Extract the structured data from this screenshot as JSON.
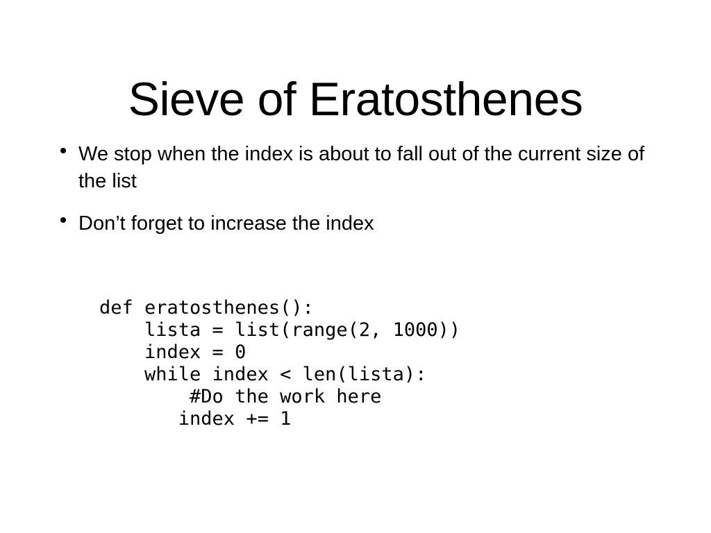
{
  "slide": {
    "background_color": "#ffffff",
    "text_color": "#000000",
    "title": "Sieve of Eratosthenes",
    "bullets": [
      {
        "text": "We stop when the index is about to fall out of the current size of the list"
      },
      {
        "text": "Don’t forget to increase the index"
      }
    ],
    "code": {
      "language": "python",
      "lines": [
        "def eratosthenes():",
        "    lista = list(range(2, 1000))",
        "    index = 0",
        "    while index < len(lista):",
        "        #Do the work here",
        "       index += 1"
      ]
    }
  }
}
